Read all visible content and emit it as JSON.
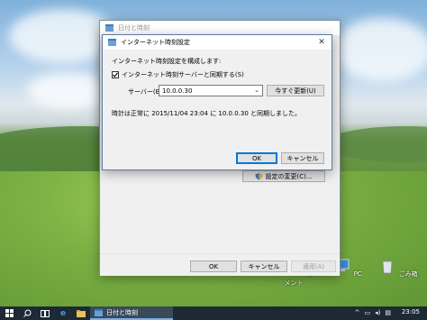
{
  "desktop": {
    "icons": [
      {
        "label": "ドキュメント",
        "icon": "documents-folder-icon"
      },
      {
        "label": "PC",
        "icon": "pc-icon"
      },
      {
        "label": "ごみ箱",
        "icon": "recycle-bin-icon"
      }
    ]
  },
  "main_window": {
    "title": "日付と時刻",
    "change_settings_label": "設定の変更(C)...",
    "ok_label": "OK",
    "cancel_label": "キャンセル",
    "apply_label": "適用(A)"
  },
  "dialog": {
    "title": "インターネット時刻設定",
    "heading": "インターネット時刻設定を構成します:",
    "sync_checkbox_label": "インターネット時刻サーバーと同期する(S)",
    "sync_checked": true,
    "server_label": "サーバー(E):",
    "server_value": "10.0.0.30",
    "update_now_label": "今すぐ更新(U)",
    "status_text": "時計は正常に 2015/11/04 23:04 に 10.0.0.30 と同期しました。",
    "ok_label": "OK",
    "cancel_label": "キャンセル"
  },
  "taskbar": {
    "app_label": "日付と時刻",
    "clock": "23:05",
    "accent": "#1d2a35"
  }
}
